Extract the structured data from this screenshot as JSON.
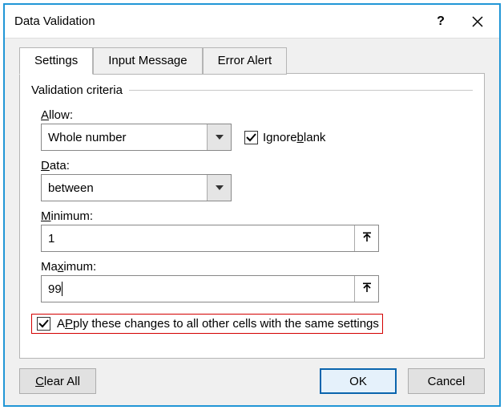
{
  "dialog": {
    "title": "Data Validation"
  },
  "tabs": {
    "settings": "Settings",
    "input_message": "Input Message",
    "error_alert": "Error Alert"
  },
  "group": {
    "title": "Validation criteria"
  },
  "allow": {
    "label_pre": "",
    "label_u": "A",
    "label_post": "llow:",
    "value": "Whole number"
  },
  "ignore_blank": {
    "label_pre": "Ignore ",
    "label_u": "b",
    "label_post": "lank",
    "checked": true
  },
  "data_field": {
    "label_u": "D",
    "label_post": "ata:",
    "value": "between"
  },
  "minimum": {
    "label_u": "M",
    "label_post": "inimum:",
    "value": "1"
  },
  "maximum": {
    "label_pre": "Ma",
    "label_u": "x",
    "label_post": "imum:",
    "value": "99"
  },
  "apply": {
    "label_pre": "Apply these changes to all other cells with the same settings",
    "label_u": "",
    "checked": true,
    "underline_char": "P",
    "full_before_u": "A",
    "full_after_u": "ply these changes to all other cells with the same settings"
  },
  "buttons": {
    "clear_u": "C",
    "clear_post": "lear All",
    "ok": "OK",
    "cancel": "Cancel"
  }
}
